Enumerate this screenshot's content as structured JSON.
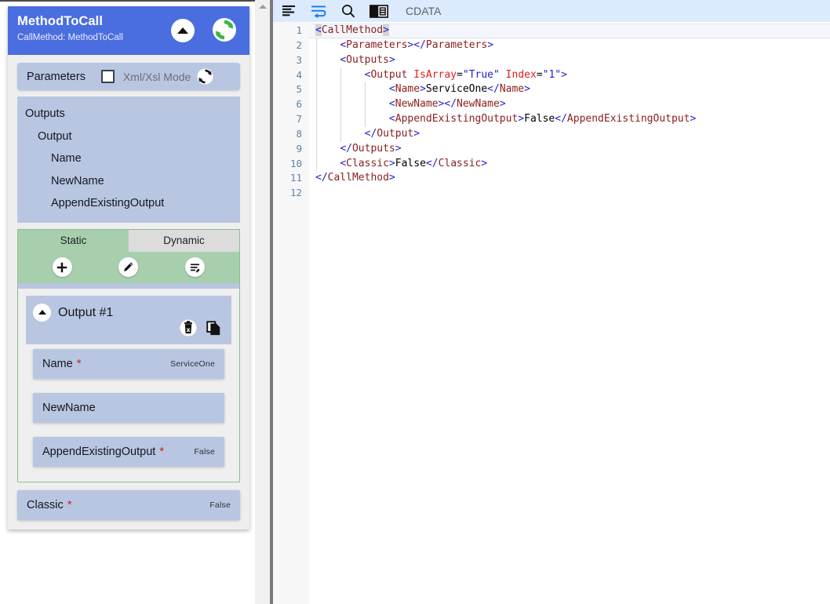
{
  "left_panel": {
    "node": {
      "title": "MethodToCall",
      "subtitle": "CallMethod: MethodToCall",
      "collapse_icon": "triangle-up-icon",
      "refresh_icon": "refresh-circular-arrows-icon"
    },
    "params_bar": {
      "label": "Parameters",
      "checkbox_checked": false,
      "mode_label": "Xml/Xsl Mode",
      "refresh_icon": "refresh-small-icon"
    },
    "tree": {
      "items": [
        {
          "label": "Outputs",
          "depth": 0
        },
        {
          "label": "Output",
          "depth": 1
        },
        {
          "label": "Name",
          "depth": 2
        },
        {
          "label": "NewName",
          "depth": 2
        },
        {
          "label": "AppendExistingOutput",
          "depth": 2
        }
      ]
    },
    "static_dynamic": {
      "tabs": [
        {
          "label": "Static",
          "active": true
        },
        {
          "label": "Dynamic",
          "active": false
        }
      ],
      "actions": [
        {
          "name": "add-button",
          "icon": "plus-icon"
        },
        {
          "name": "edit-button",
          "icon": "pencil-icon"
        },
        {
          "name": "edit-list-button",
          "icon": "list-edit-icon"
        }
      ],
      "output_card": {
        "title": "Output #1",
        "expander_icon": "triangle-up-icon",
        "delete_icon": "trash-x-icon",
        "copy_icon": "copy-duplicate-icon",
        "fields": [
          {
            "name": "Name",
            "required": true,
            "value": "ServiceOne"
          },
          {
            "name": "NewName",
            "required": false,
            "value": ""
          },
          {
            "name": "AppendExistingOutput",
            "required": true,
            "value": "False"
          }
        ]
      }
    },
    "classic_field": {
      "name": "Classic",
      "required": true,
      "value": "False"
    }
  },
  "editor": {
    "toolbar": {
      "items": [
        {
          "name": "format-lines-icon",
          "label": ""
        },
        {
          "name": "word-wrap-icon",
          "label": ""
        },
        {
          "name": "search-icon",
          "label": ""
        },
        {
          "name": "toggle-panel-icon",
          "label": ""
        }
      ],
      "cdata_label": "CDATA"
    },
    "line_numbers": [
      "1",
      "2",
      "3",
      "4",
      "5",
      "6",
      "7",
      "8",
      "9",
      "10",
      "11",
      "12"
    ],
    "current_line": 1,
    "lines": [
      {
        "n": 1,
        "indent": 0,
        "tokens": [
          {
            "t": "brsel",
            "v": "<"
          },
          {
            "t": "tag",
            "v": "CallMethod"
          },
          {
            "t": "brsel",
            "v": ">"
          }
        ]
      },
      {
        "n": 2,
        "indent": 1,
        "tokens": [
          {
            "t": "br",
            "v": "<"
          },
          {
            "t": "tag",
            "v": "Parameters"
          },
          {
            "t": "br",
            "v": "></"
          },
          {
            "t": "tag",
            "v": "Parameters"
          },
          {
            "t": "br",
            "v": ">"
          }
        ]
      },
      {
        "n": 3,
        "indent": 1,
        "tokens": [
          {
            "t": "br",
            "v": "<"
          },
          {
            "t": "tag",
            "v": "Outputs"
          },
          {
            "t": "br",
            "v": ">"
          }
        ]
      },
      {
        "n": 4,
        "indent": 2,
        "tokens": [
          {
            "t": "br",
            "v": "<"
          },
          {
            "t": "tag",
            "v": "Output"
          },
          {
            "t": "txt",
            "v": " "
          },
          {
            "t": "attr",
            "v": "IsArray"
          },
          {
            "t": "txt",
            "v": "="
          },
          {
            "t": "val",
            "v": "\"True\""
          },
          {
            "t": "txt",
            "v": " "
          },
          {
            "t": "attr",
            "v": "Index"
          },
          {
            "t": "txt",
            "v": "="
          },
          {
            "t": "val",
            "v": "\"1\""
          },
          {
            "t": "br",
            "v": ">"
          }
        ]
      },
      {
        "n": 5,
        "indent": 3,
        "tokens": [
          {
            "t": "br",
            "v": "<"
          },
          {
            "t": "tag",
            "v": "Name"
          },
          {
            "t": "br",
            "v": ">"
          },
          {
            "t": "txt",
            "v": "ServiceOne"
          },
          {
            "t": "br",
            "v": "</"
          },
          {
            "t": "tag",
            "v": "Name"
          },
          {
            "t": "br",
            "v": ">"
          }
        ]
      },
      {
        "n": 6,
        "indent": 3,
        "tokens": [
          {
            "t": "br",
            "v": "<"
          },
          {
            "t": "tag",
            "v": "NewName"
          },
          {
            "t": "br",
            "v": "></"
          },
          {
            "t": "tag",
            "v": "NewName"
          },
          {
            "t": "br",
            "v": ">"
          }
        ]
      },
      {
        "n": 7,
        "indent": 3,
        "tokens": [
          {
            "t": "br",
            "v": "<"
          },
          {
            "t": "tag",
            "v": "AppendExistingOutput"
          },
          {
            "t": "br",
            "v": ">"
          },
          {
            "t": "txt",
            "v": "False"
          },
          {
            "t": "br",
            "v": "</"
          },
          {
            "t": "tag",
            "v": "AppendExistingOutput"
          },
          {
            "t": "br",
            "v": ">"
          }
        ]
      },
      {
        "n": 8,
        "indent": 2,
        "tokens": [
          {
            "t": "br",
            "v": "</"
          },
          {
            "t": "tag",
            "v": "Output"
          },
          {
            "t": "br",
            "v": ">"
          }
        ]
      },
      {
        "n": 9,
        "indent": 1,
        "tokens": [
          {
            "t": "br",
            "v": "</"
          },
          {
            "t": "tag",
            "v": "Outputs"
          },
          {
            "t": "br",
            "v": ">"
          }
        ]
      },
      {
        "n": 10,
        "indent": 1,
        "tokens": [
          {
            "t": "br",
            "v": "<"
          },
          {
            "t": "tag",
            "v": "Classic"
          },
          {
            "t": "br",
            "v": ">"
          },
          {
            "t": "txt",
            "v": "False"
          },
          {
            "t": "br",
            "v": "</"
          },
          {
            "t": "tag",
            "v": "Classic"
          },
          {
            "t": "br",
            "v": ">"
          }
        ]
      },
      {
        "n": 11,
        "indent": 0,
        "tokens": [
          {
            "t": "br",
            "v": "</"
          },
          {
            "t": "tag",
            "v": "CallMethod"
          },
          {
            "t": "br",
            "v": ">"
          }
        ]
      },
      {
        "n": 12,
        "indent": 0,
        "tokens": []
      }
    ]
  },
  "colors": {
    "node_header": "#4a6ee0",
    "field_blue": "#b9c6e2",
    "tab_green": "#a8cfad",
    "toolbar_blue": "#dbeafd",
    "required_star": "#cc2222",
    "xml_tag": "#8b2020",
    "xml_bracket": "#2222cc",
    "xml_attr": "#e02020"
  }
}
